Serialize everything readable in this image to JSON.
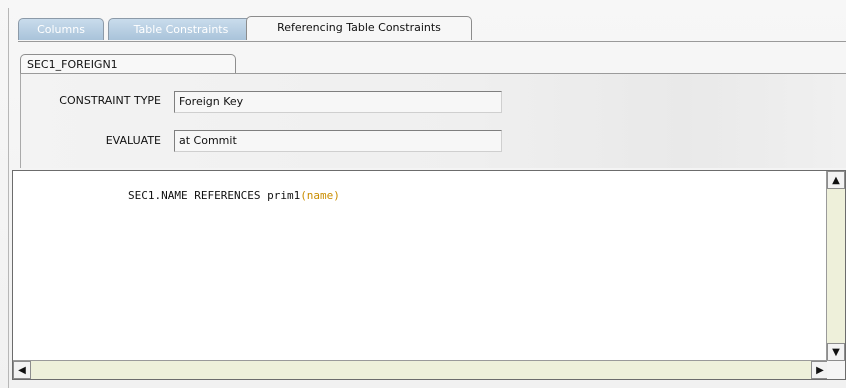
{
  "tabs": [
    {
      "label": "Columns",
      "active": false
    },
    {
      "label": "Table Constraints",
      "active": false
    },
    {
      "label": "Referencing Table Constraints",
      "active": true
    }
  ],
  "subtab": {
    "label": "SEC1_FOREIGN1"
  },
  "fields": {
    "constraint_type": {
      "label": "CONSTRAINT TYPE",
      "value": "Foreign Key"
    },
    "evaluate": {
      "label": "EVALUATE",
      "value": "at Commit"
    }
  },
  "editor": {
    "code_prefix": "SEC1.NAME REFERENCES prim1",
    "code_paren": "(name)"
  },
  "icons": {
    "scroll_up": "up-arrow-icon",
    "scroll_down": "down-arrow-icon",
    "scroll_left": "left-arrow-icon",
    "scroll_right": "right-arrow-icon"
  },
  "colors": {
    "inactive_tab": "#b9d0e6",
    "paren_accent": "#c98d00"
  }
}
